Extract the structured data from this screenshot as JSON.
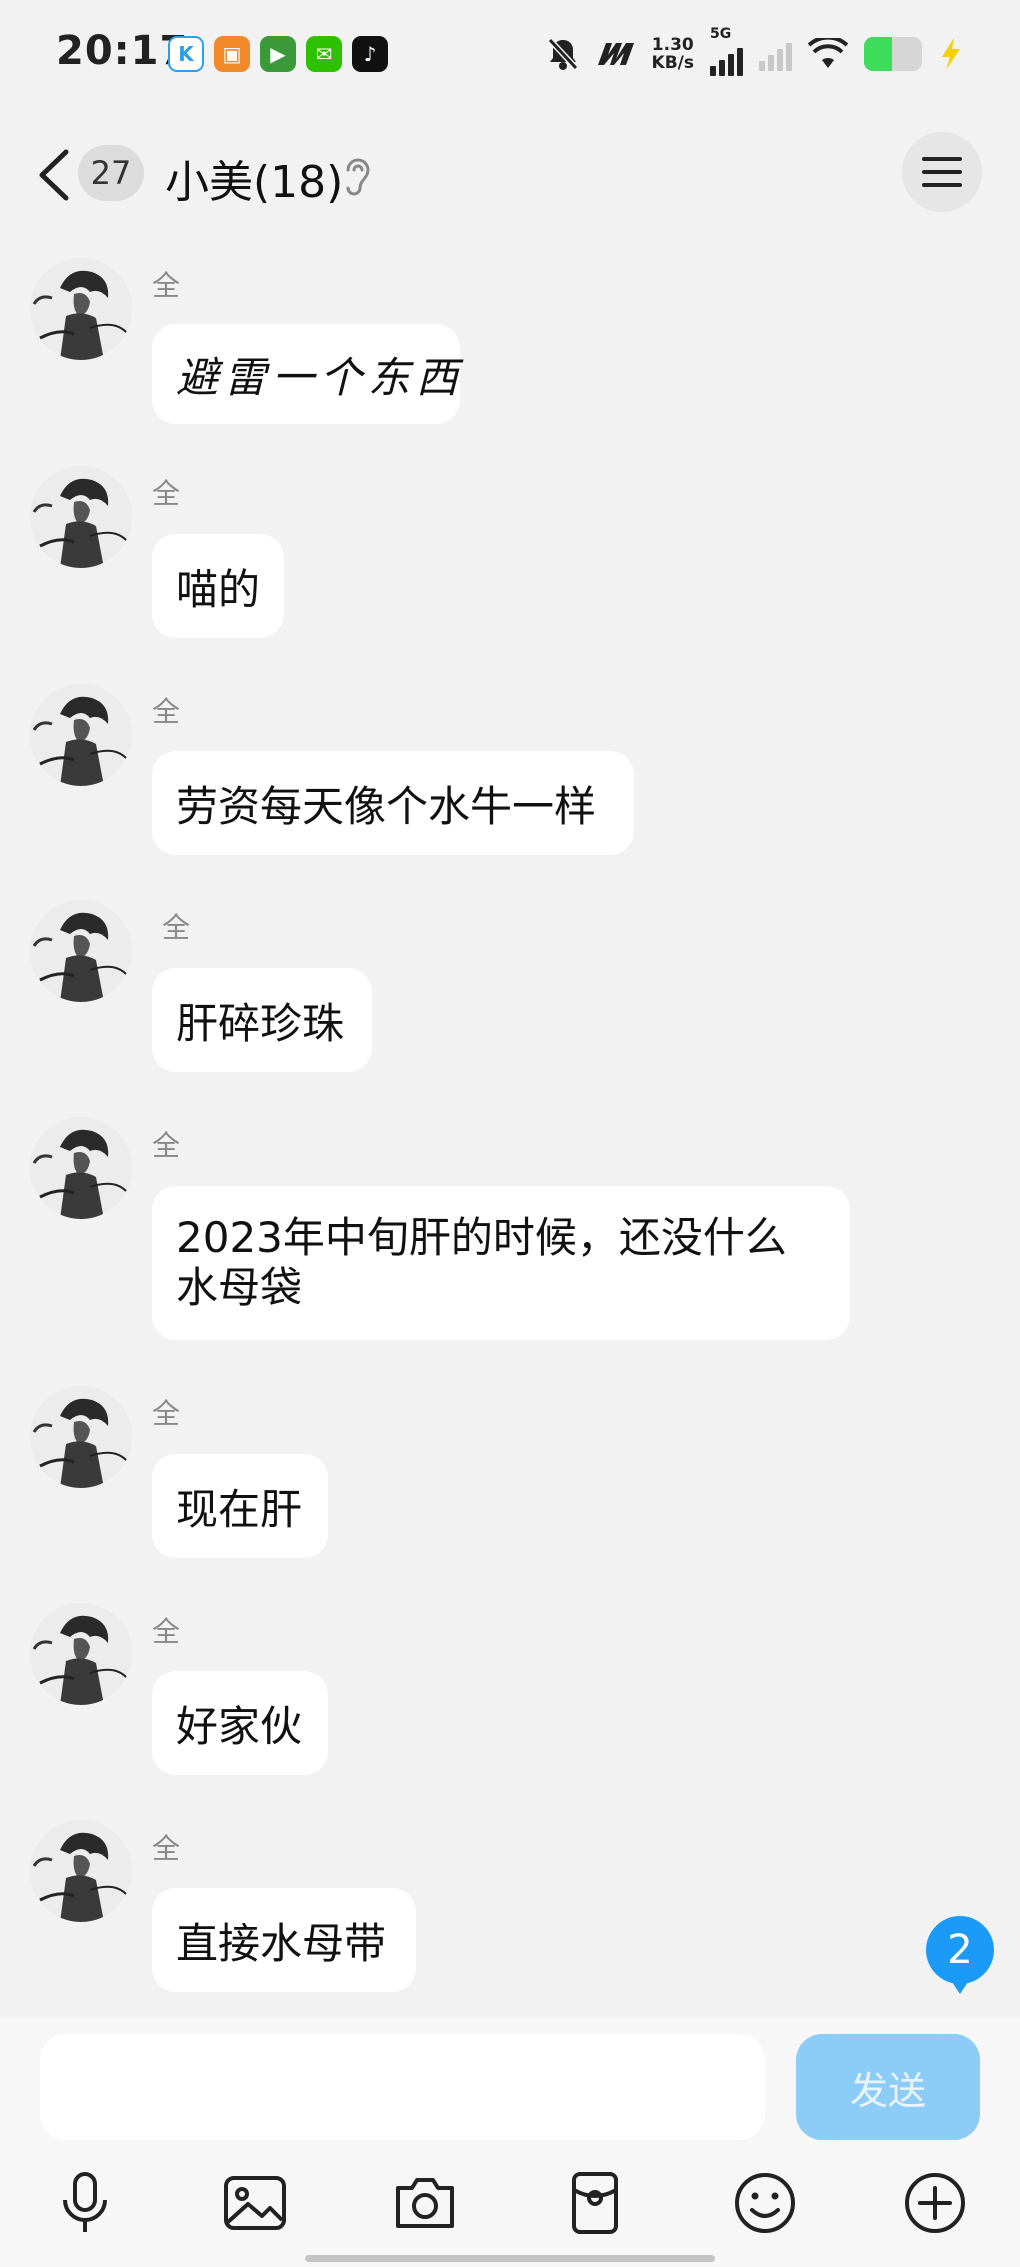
{
  "status_bar": {
    "time": "20:17",
    "net_speed_value": "1.30",
    "net_speed_unit": "KB/s",
    "network_type": "5G",
    "app_icons": [
      "k-app-icon",
      "shop-app-icon",
      "video-app-icon",
      "wechat-icon",
      "tiktok-icon"
    ],
    "battery_level": 0.45,
    "charging": true
  },
  "header": {
    "unread_count": "27",
    "title": "小美(18)"
  },
  "messages": [
    {
      "sender": "全",
      "text": "避雷一个东西"
    },
    {
      "sender": "全",
      "text": "喵的"
    },
    {
      "sender": "全",
      "text": "劳资每天像个水牛一样"
    },
    {
      "sender": "全",
      "text": "肝碎珍珠"
    },
    {
      "sender": "全",
      "text": "2023年中旬肝的时候，还没什么水母袋"
    },
    {
      "sender": "全",
      "text": "现在肝"
    },
    {
      "sender": "全",
      "text": "好家伙"
    },
    {
      "sender": "全",
      "text": "直接水母带"
    }
  ],
  "new_message_badge": "2",
  "composer": {
    "input_value": "",
    "send_label": "发送"
  },
  "toolbar_icons": [
    "microphone-icon",
    "image-icon",
    "camera-icon",
    "red-packet-icon",
    "emoji-icon",
    "plus-icon"
  ],
  "colors": {
    "background": "#f2f2f2",
    "bubble": "#ffffff",
    "accent_blue": "#1b9af7",
    "send_disabled": "#8dccf7"
  }
}
